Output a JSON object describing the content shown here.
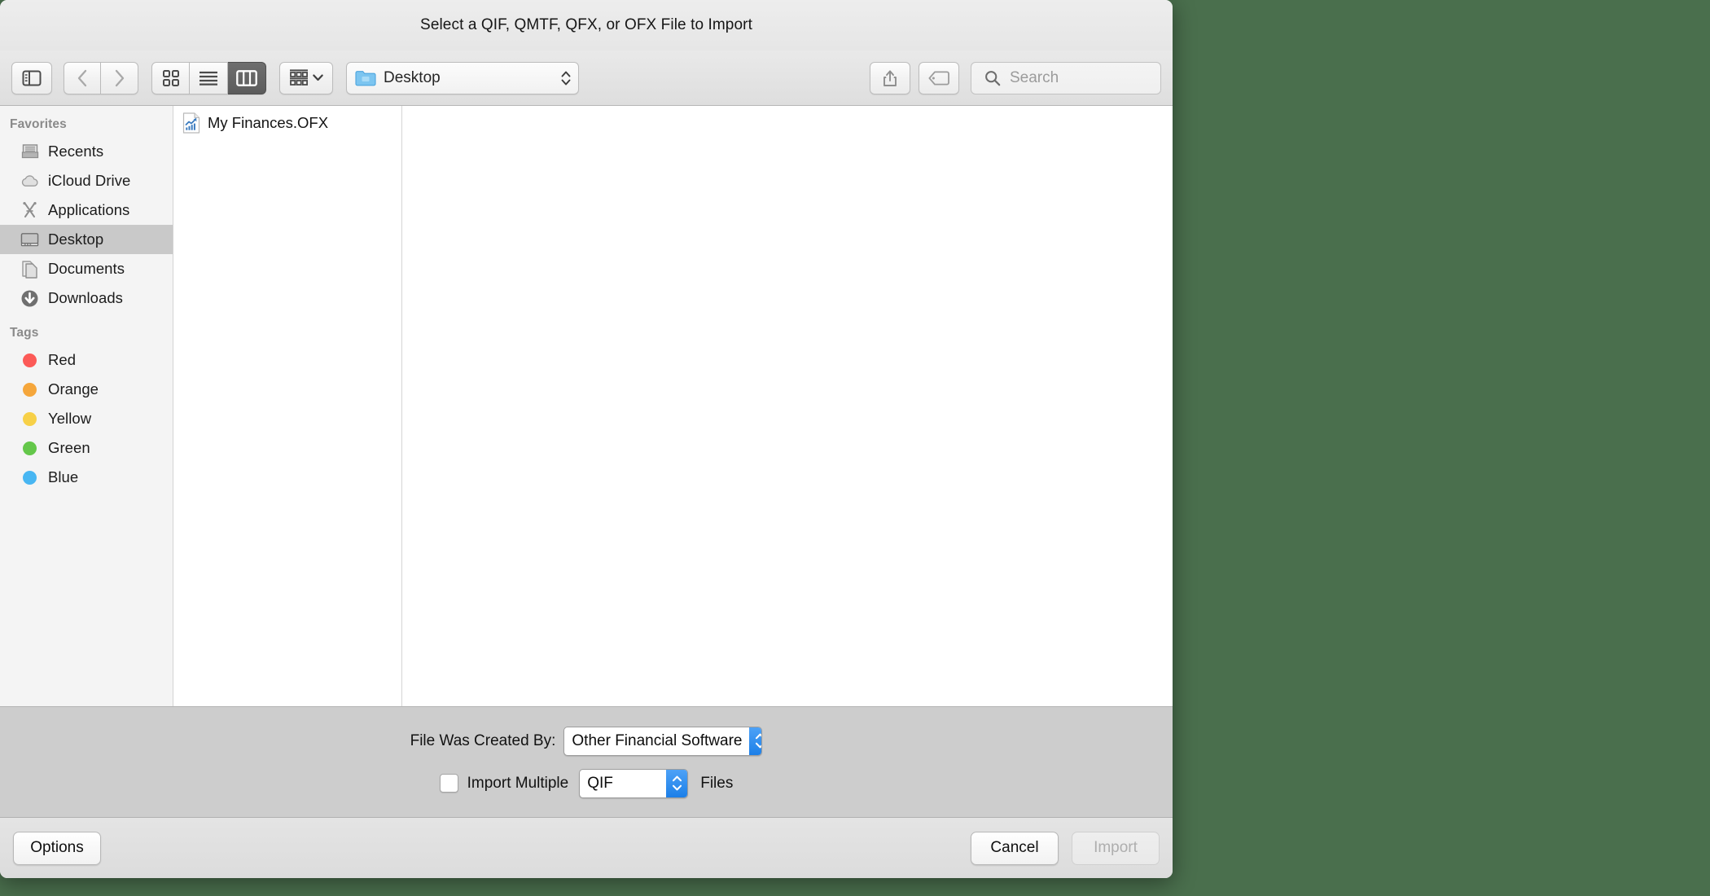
{
  "window": {
    "title": "Select a QIF, QMTF, QFX, or OFX File to Import"
  },
  "toolbar": {
    "sidebar_toggle_icon": "sidebar-toggle-icon",
    "back_icon": "chevron-left-icon",
    "forward_icon": "chevron-right-icon",
    "view_icon_grid": "icon-view-icon",
    "view_list": "list-view-icon",
    "view_column": "column-view-icon",
    "active_view": "column",
    "group_by_icon": "group-by-icon",
    "group_by_chevron": "chevron-down-icon",
    "path_label": "Desktop",
    "path_folder_icon": "folder-icon",
    "path_chevron_icon": "updown-chevron-icon",
    "share_icon": "share-icon",
    "tag_icon": "tag-icon",
    "search_icon": "search-icon",
    "search_placeholder": "Search",
    "search_value": ""
  },
  "sidebar": {
    "favorites_header": "Favorites",
    "favorites": [
      {
        "label": "Recents",
        "icon": "recents-icon",
        "selected": false
      },
      {
        "label": "iCloud Drive",
        "icon": "cloud-icon",
        "selected": false
      },
      {
        "label": "Applications",
        "icon": "applications-icon",
        "selected": false
      },
      {
        "label": "Desktop",
        "icon": "desktop-icon",
        "selected": true
      },
      {
        "label": "Documents",
        "icon": "documents-icon",
        "selected": false
      },
      {
        "label": "Downloads",
        "icon": "downloads-icon",
        "selected": false
      }
    ],
    "tags_header": "Tags",
    "tags": [
      {
        "label": "Red",
        "color": "#fc5a57"
      },
      {
        "label": "Orange",
        "color": "#f5a63b"
      },
      {
        "label": "Yellow",
        "color": "#f7d047"
      },
      {
        "label": "Green",
        "color": "#64c74a"
      },
      {
        "label": "Blue",
        "color": "#48b6f2"
      }
    ]
  },
  "browser": {
    "column1_files": [
      {
        "name": "My Finances.OFX",
        "icon": "ofx-document-icon",
        "selected": false
      }
    ],
    "column2_files": []
  },
  "accessory": {
    "created_by_label": "File Was Created By:",
    "created_by_value": "Other Financial Software",
    "import_multiple_checked": false,
    "import_multiple_label": "Import Multiple",
    "file_type_value": "QIF",
    "files_label": "Files"
  },
  "footer": {
    "options_label": "Options",
    "cancel_label": "Cancel",
    "import_label": "Import",
    "import_disabled": true
  },
  "colors": {
    "desktop_background": "#4a6f4d",
    "selection_grey": "#c9c9c9",
    "accent_blue": "#1c7fe8"
  }
}
